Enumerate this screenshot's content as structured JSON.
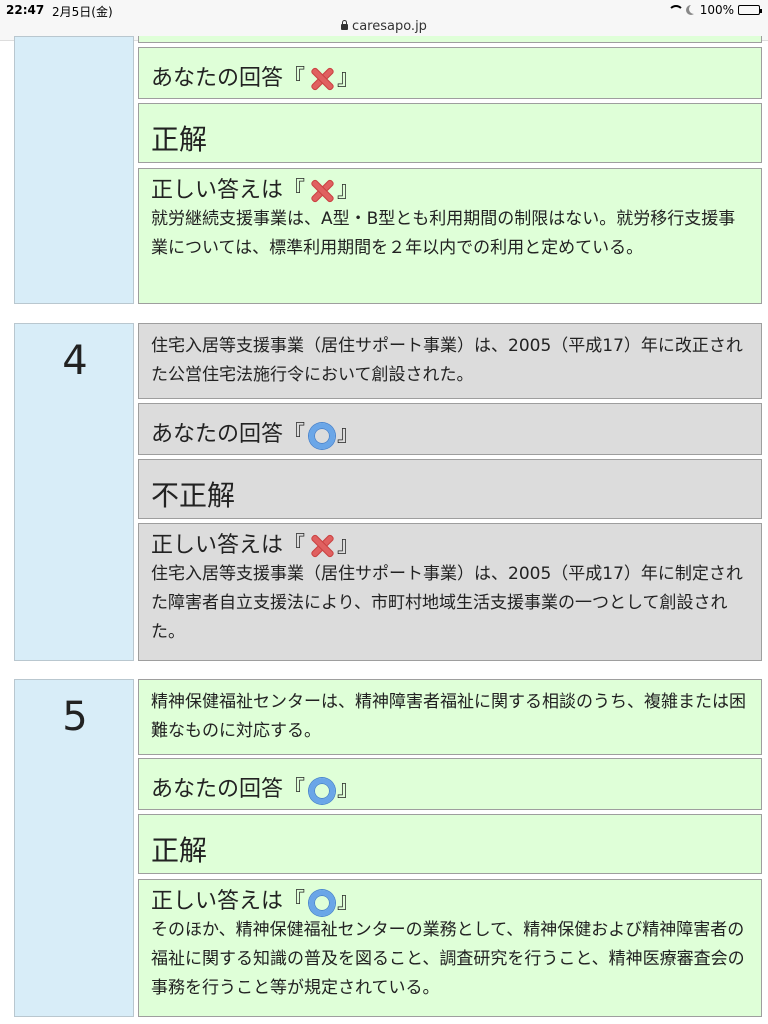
{
  "status_bar": {
    "time": "22:47",
    "date": "2月5日(金)",
    "url": "caresapo.jp",
    "battery": "100%"
  },
  "labels": {
    "your_answer": "あなたの回答『",
    "correct_answer": "正しい答えは『",
    "bracket_close": "』"
  },
  "q3": {
    "your_answer_mark": "cross-mark-icon",
    "verdict": "正解",
    "correct_mark": "cross-mark-icon",
    "explanation": "就労継続支援事業は、A型・B型とも利用期間の制限はない。就労移行支援事業については、標準利用期間を２年以内での利用と定めている。"
  },
  "q4": {
    "number": "4",
    "question": "住宅入居等支援事業（居住サポート事業）は、2005（平成17）年に改正された公営住宅法施行令において創設された。",
    "your_answer_mark": "circle-mark-icon",
    "verdict": "不正解",
    "correct_mark": "cross-mark-icon",
    "explanation": "住宅入居等支援事業（居住サポート事業）は、2005（平成17）年に制定された障害者自立支援法により、市町村地域生活支援事業の一つとして創設された。"
  },
  "q5": {
    "number": "5",
    "question": "精神保健福祉センターは、精神障害者福祉に関する相談のうち、複雑または困難なものに対応する。",
    "your_answer_mark": "circle-mark-icon",
    "verdict": "正解",
    "correct_mark": "circle-mark-icon",
    "explanation": "そのほか、精神保健福祉センターの業務として、精神保健および精神障害者の福祉に関する知識の普及を図ること、調査研究を行うこと、精神医療審査会の事務を行うこと等が規定されている。"
  }
}
